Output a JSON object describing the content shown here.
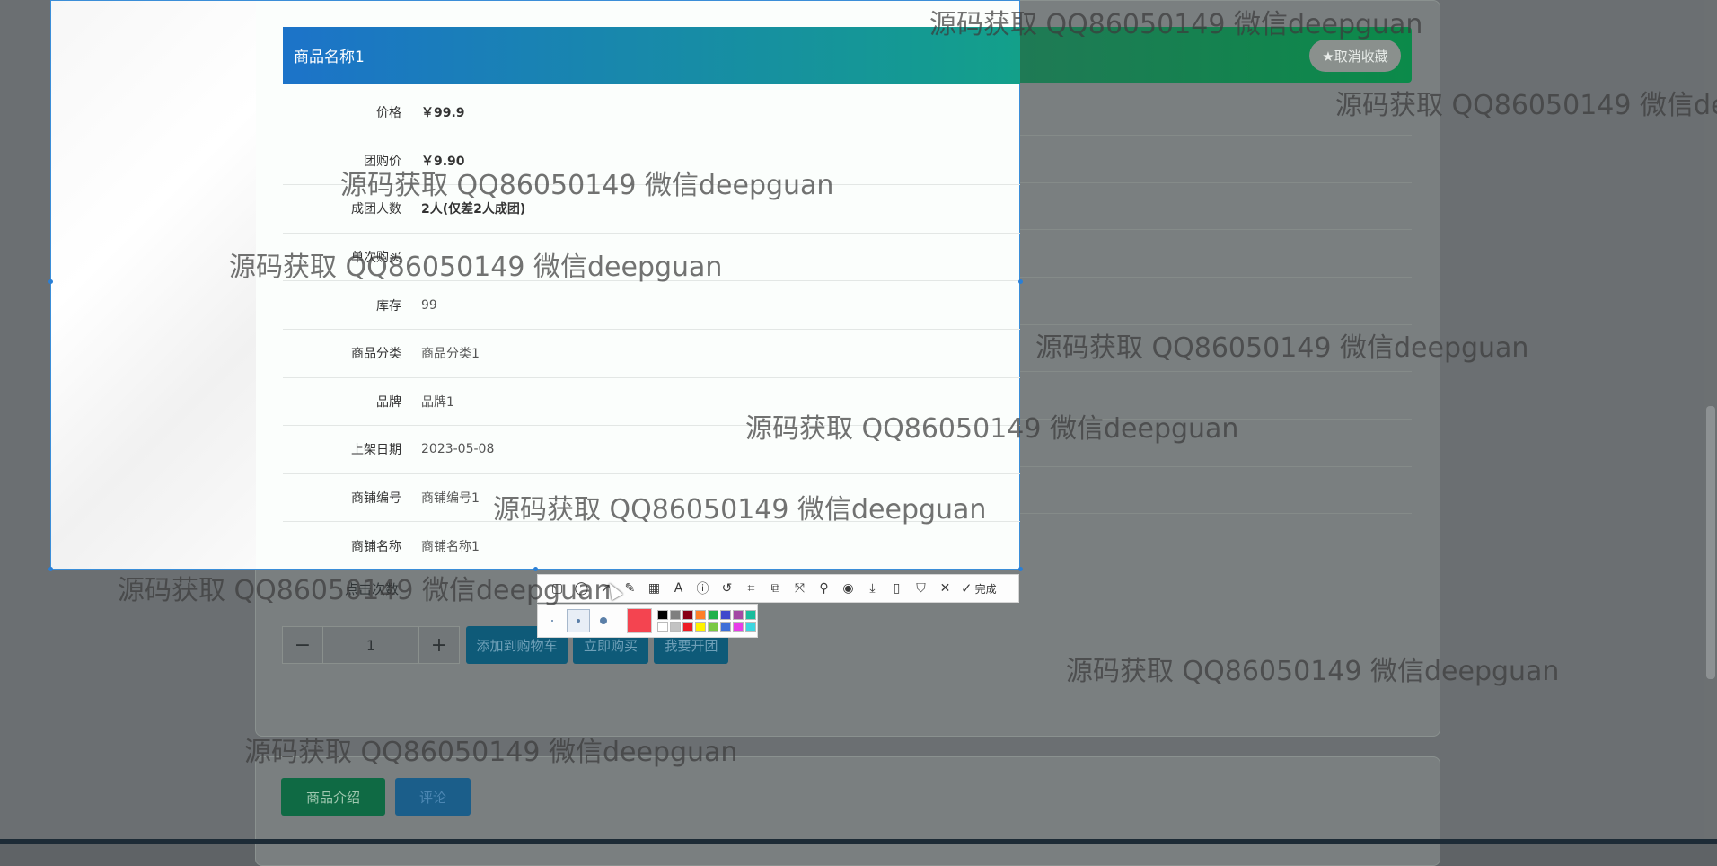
{
  "product": {
    "name": "商品名称1",
    "rows": [
      {
        "label": "价格",
        "value": "￥99.9",
        "bold": true
      },
      {
        "label": "团购价",
        "value": "￥9.90",
        "bold": true
      },
      {
        "label": "成团人数",
        "value": "2人(仅差2人成团)",
        "bold": true
      },
      {
        "label": "单次购买",
        "value": "",
        "bold": false
      },
      {
        "label": "库存",
        "value": "99",
        "bold": false
      },
      {
        "label": "商品分类",
        "value": "商品分类1",
        "bold": false
      },
      {
        "label": "品牌",
        "value": "品牌1",
        "bold": false
      },
      {
        "label": "上架日期",
        "value": "2023-05-08",
        "bold": false
      },
      {
        "label": "商铺编号",
        "value": "商铺编号1",
        "bold": false
      },
      {
        "label": "商铺名称",
        "value": "商铺名称1",
        "bold": false
      }
    ],
    "partial_label": "点击次数"
  },
  "favorite_button": "★取消收藏",
  "quantity": {
    "minus": "−",
    "value": "1",
    "plus": "+"
  },
  "actions": {
    "add_to_cart": "添加到购物车",
    "buy_now": "立即购买",
    "start_group": "我要开团"
  },
  "tabs": {
    "intro": "商品介绍",
    "review": "评论"
  },
  "screenshot_tool": {
    "done_label": "完成",
    "icons": [
      "rectangle-icon",
      "circle-icon",
      "arrow-icon",
      "pencil-icon",
      "mosaic-icon",
      "text-icon",
      "number-icon",
      "undo-icon",
      "ocr-icon",
      "translate-icon",
      "scroll-capture-icon",
      "pin-icon",
      "record-icon",
      "save-icon",
      "copy-to-phone-icon",
      "bookmark-icon",
      "close-icon"
    ],
    "current_color": "#f44450",
    "swatches": [
      "#000000",
      "#7f7f7f",
      "#880015",
      "#ff7f27",
      "#22b14c",
      "#3f48cc",
      "#a349a4",
      "#1abc9c",
      "#ffffff",
      "#c3c3c3",
      "#ed1c24",
      "#fff200",
      "#7ac943",
      "#3f6fd8",
      "#e73ce8",
      "#3cd6e0"
    ]
  },
  "watermark_text": "源码获取 QQ86050149 微信deepguan"
}
